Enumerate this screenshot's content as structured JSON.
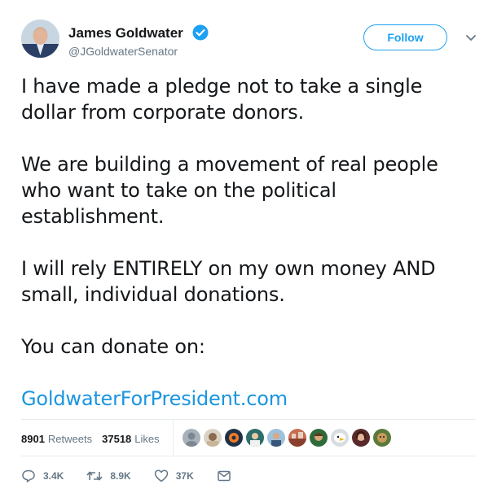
{
  "header": {
    "display_name": "James Goldwater",
    "handle": "@JGoldwaterSenator",
    "follow_label": "Follow"
  },
  "tweet": {
    "paragraph_1": "I have made a pledge not to take a single dollar from corporate donors.",
    "paragraph_2": "We are building a movement of real people who want to take on the political establishment.",
    "paragraph_3": "I will rely ENTIRELY on my own money AND small, individual donations.",
    "paragraph_4": "You can donate on:",
    "link": "GoldwaterForPresident.com"
  },
  "stats": {
    "retweets_count": "8901",
    "retweets_label": "Retweets",
    "likes_count": "37518",
    "likes_label": "Likes"
  },
  "actions": {
    "reply_count": "3.4K",
    "retweet_count": "8.9K",
    "like_count": "37K"
  },
  "colors": {
    "accent": "#1da1f2",
    "link": "#1b95e0",
    "muted": "#657786"
  }
}
